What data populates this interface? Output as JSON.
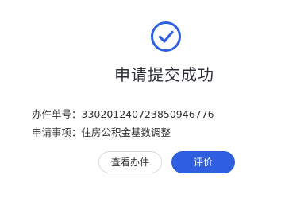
{
  "icons": {
    "success": "check-circle-icon"
  },
  "colors": {
    "accent": "#2F5FE0",
    "title": "#2B2F36",
    "text": "#333333"
  },
  "result": {
    "title": "申请提交成功",
    "case_number_label": "办件单号：",
    "case_number": "330201240723850946776",
    "matter_label": "申请事项：",
    "matter": "住房公积金基数调整"
  },
  "actions": {
    "view_label": "查看办件",
    "rate_label": "评价"
  }
}
